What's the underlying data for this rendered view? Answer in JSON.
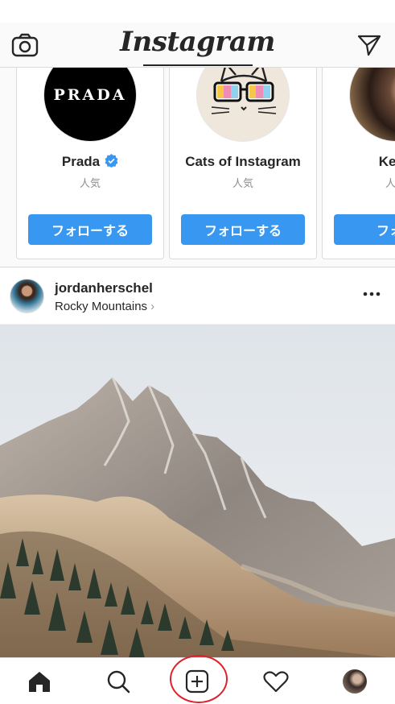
{
  "app": {
    "title": "Instagram"
  },
  "top_bar": {
    "logo": "Instagram",
    "left_icon": "camera-icon",
    "right_icon": "direct-message-icon"
  },
  "suggestions": [
    {
      "name": "Prada",
      "verified": true,
      "subtitle": "人気",
      "button": "フォローする"
    },
    {
      "name": "Cats of Instagram",
      "verified": false,
      "subtitle": "人気",
      "button": "フォローする"
    },
    {
      "name": "Kend",
      "verified": false,
      "subtitle": "人気",
      "button": "フォロ"
    }
  ],
  "prada_logo_text": "PRADA",
  "post": {
    "username": "jordanherschel",
    "location": "Rocky Mountains",
    "location_chevron": "›",
    "more_icon": "more-options-icon"
  },
  "tab_bar": {
    "items": [
      "home-icon",
      "search-icon",
      "new-post-icon",
      "activity-heart-icon",
      "profile-avatar"
    ]
  },
  "colors": {
    "accent": "#3897f0",
    "text": "#262626",
    "muted": "#8e8e8e",
    "highlight": "#e0202a"
  }
}
